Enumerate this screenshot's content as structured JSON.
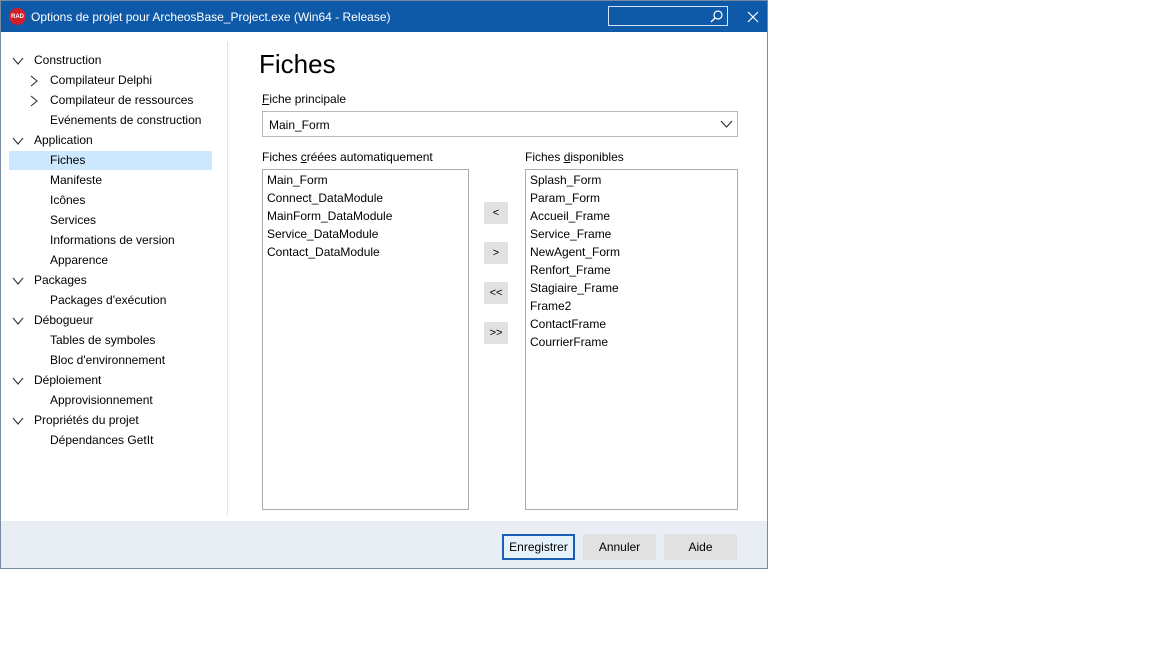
{
  "window": {
    "title": "Options de projet pour ArcheosBase_Project.exe  (Win64 - Release)",
    "app_icon_text": "RAD",
    "search_placeholder": ""
  },
  "sidebar": {
    "items": [
      {
        "label": "Construction",
        "level": 0,
        "toggle": "expanded"
      },
      {
        "label": "Compilateur Delphi",
        "level": 1,
        "toggle": "collapsed"
      },
      {
        "label": "Compilateur de ressources",
        "level": 1,
        "toggle": "collapsed"
      },
      {
        "label": "Evénements de construction",
        "level": 1,
        "toggle": "none"
      },
      {
        "label": "Application",
        "level": 0,
        "toggle": "expanded"
      },
      {
        "label": "Fiches",
        "level": 1,
        "toggle": "none",
        "selected": true
      },
      {
        "label": "Manifeste",
        "level": 1,
        "toggle": "none"
      },
      {
        "label": "Icônes",
        "level": 1,
        "toggle": "none"
      },
      {
        "label": "Services",
        "level": 1,
        "toggle": "none"
      },
      {
        "label": "Informations de version",
        "level": 1,
        "toggle": "none"
      },
      {
        "label": "Apparence",
        "level": 1,
        "toggle": "none"
      },
      {
        "label": "Packages",
        "level": 0,
        "toggle": "expanded"
      },
      {
        "label": "Packages d'exécution",
        "level": 1,
        "toggle": "none"
      },
      {
        "label": "Débogueur",
        "level": 0,
        "toggle": "expanded"
      },
      {
        "label": "Tables de symboles",
        "level": 1,
        "toggle": "none"
      },
      {
        "label": "Bloc d'environnement",
        "level": 1,
        "toggle": "none"
      },
      {
        "label": "Déploiement",
        "level": 0,
        "toggle": "expanded"
      },
      {
        "label": "Approvisionnement",
        "level": 1,
        "toggle": "none"
      },
      {
        "label": "Propriétés du projet",
        "level": 0,
        "toggle": "expanded"
      },
      {
        "label": "Dépendances GetIt",
        "level": 1,
        "toggle": "none"
      }
    ]
  },
  "main": {
    "title": "Fiches",
    "main_form_label_u": "F",
    "main_form_label_rest": "iche principale",
    "main_form_value": "Main_Form",
    "auto_label_pre": "Fiches ",
    "auto_label_u": "c",
    "auto_label_post": "réées automatiquement",
    "avail_label_pre": "Fiches ",
    "avail_label_u": "d",
    "avail_label_post": "isponibles",
    "auto_forms": [
      "Main_Form",
      "Connect_DataModule",
      "MainForm_DataModule",
      "Service_DataModule",
      "Contact_DataModule"
    ],
    "available_forms": [
      "Splash_Form",
      "Param_Form",
      "Accueil_Frame",
      "Service_Frame",
      "NewAgent_Form",
      "Renfort_Frame",
      "Stagiaire_Frame",
      "Frame2",
      "ContactFrame",
      "CourrierFrame"
    ],
    "move_buttons": [
      "<",
      ">",
      "<<",
      ">>"
    ]
  },
  "footer": {
    "save_label": "Enregistrer",
    "cancel_label": "Annuler",
    "help_label": "Aide"
  },
  "colors": {
    "titlebar": "#0f5aa8",
    "selection": "#cce8ff",
    "default_button_border": "#1a5fb4",
    "footer_bg": "#e9eef4"
  }
}
